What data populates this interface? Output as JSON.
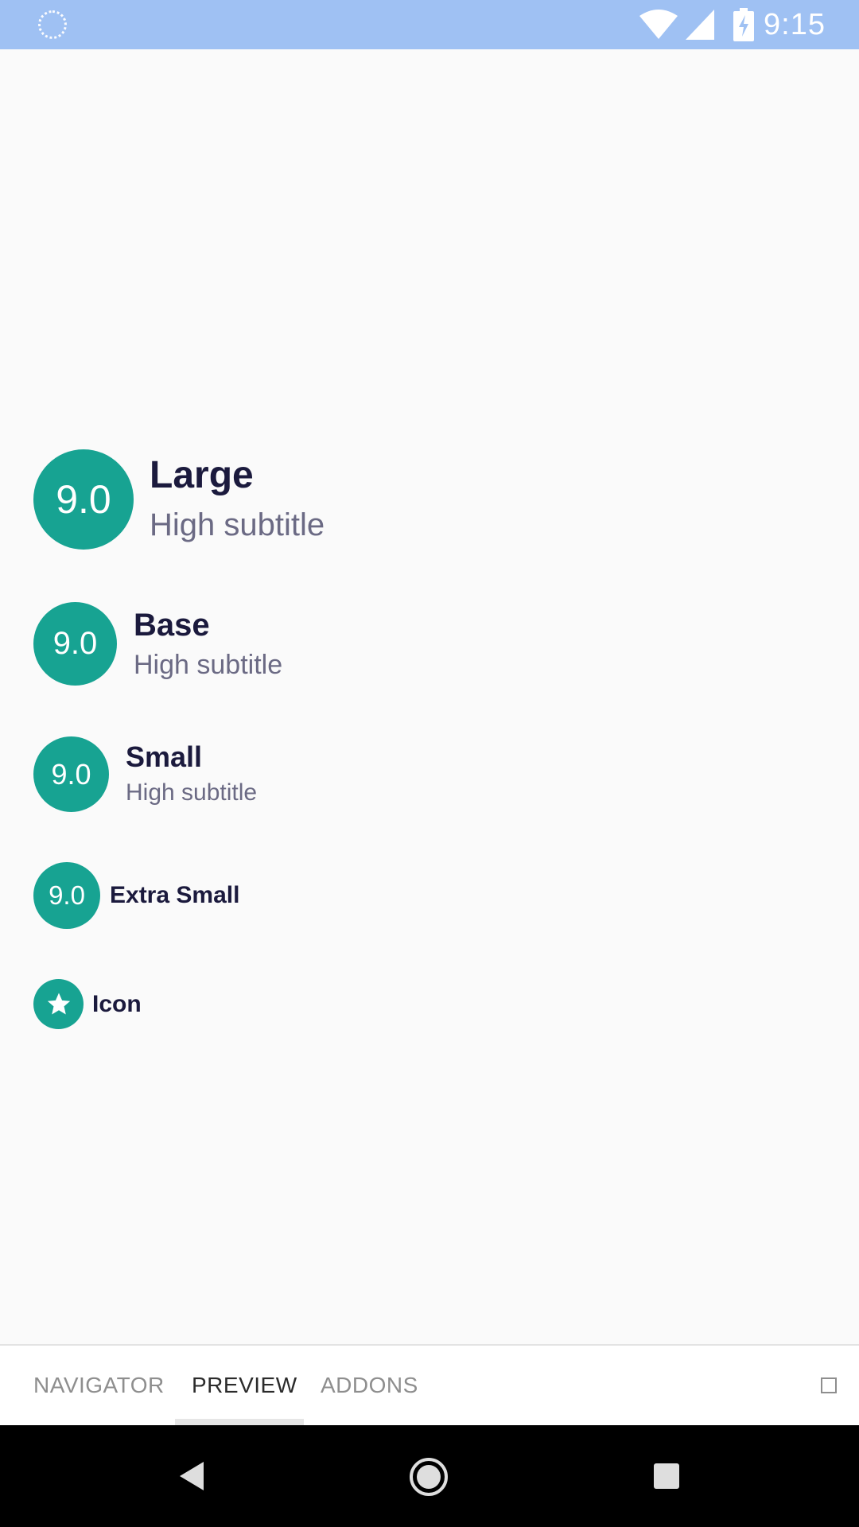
{
  "status_bar": {
    "time": "9:15",
    "icons": [
      "loading-icon",
      "wifi-icon",
      "cell-signal-icon",
      "battery-charging-icon"
    ],
    "background_color": "#9fc1f3"
  },
  "avatar_list": {
    "accent_color": "#17a392",
    "items": [
      {
        "size": "large",
        "avatar_text": "9.0",
        "title": "Large",
        "subtitle": "High subtitle"
      },
      {
        "size": "base",
        "avatar_text": "9.0",
        "title": "Base",
        "subtitle": "High subtitle"
      },
      {
        "size": "small",
        "avatar_text": "9.0",
        "title": "Small",
        "subtitle": "High subtitle"
      },
      {
        "size": "extra-small",
        "avatar_text": "9.0",
        "title": "Extra Small"
      },
      {
        "size": "icon",
        "avatar_icon": "star-icon",
        "title": "Icon"
      }
    ]
  },
  "bottom_tabs": {
    "tabs": [
      {
        "label": "NAVIGATOR",
        "active": false
      },
      {
        "label": "PREVIEW",
        "active": true
      },
      {
        "label": "ADDONS",
        "active": false
      }
    ],
    "right_icon": "square-icon"
  },
  "nav_bar": {
    "icons": [
      "back-icon",
      "home-icon",
      "recents-icon"
    ]
  }
}
